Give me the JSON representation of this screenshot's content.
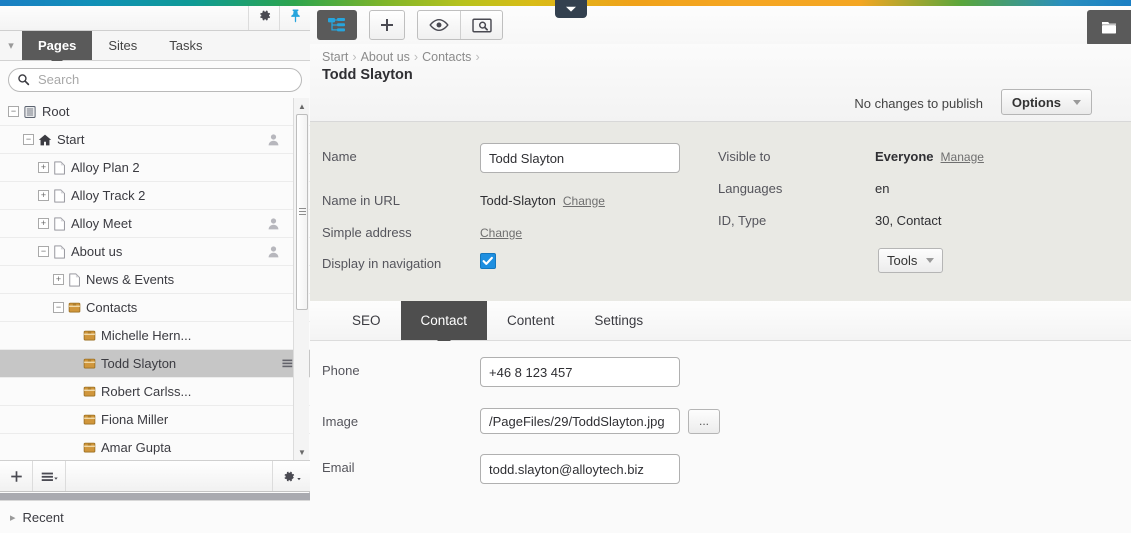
{
  "sidebar": {
    "topbar_icons": [
      {
        "name": "gear-icon",
        "label": "Settings"
      },
      {
        "name": "pin-icon",
        "label": "Pin panel"
      }
    ],
    "tabs": [
      {
        "label": "Pages",
        "active": true
      },
      {
        "label": "Sites",
        "active": false
      },
      {
        "label": "Tasks",
        "active": false
      }
    ],
    "search": {
      "placeholder": "Search",
      "value": ""
    },
    "tree": [
      {
        "label": "Root",
        "indent": 0,
        "expander": "minus",
        "icon": "root-icon",
        "user": false,
        "selected": false
      },
      {
        "label": "Start",
        "indent": 1,
        "expander": "minus",
        "icon": "home-icon",
        "user": true,
        "selected": false
      },
      {
        "label": "Alloy Plan 2",
        "indent": 2,
        "expander": "plus",
        "icon": "page-icon",
        "user": false,
        "selected": false
      },
      {
        "label": "Alloy Track 2",
        "indent": 2,
        "expander": "plus",
        "icon": "page-icon",
        "user": false,
        "selected": false
      },
      {
        "label": "Alloy Meet",
        "indent": 2,
        "expander": "plus",
        "icon": "page-icon",
        "user": true,
        "selected": false
      },
      {
        "label": "About us",
        "indent": 2,
        "expander": "minus",
        "icon": "page-icon",
        "user": true,
        "selected": false
      },
      {
        "label": "News & Events",
        "indent": 3,
        "expander": "plus",
        "icon": "page-icon",
        "user": false,
        "selected": false
      },
      {
        "label": "Contacts",
        "indent": 3,
        "expander": "minus",
        "icon": "contact-icon",
        "user": false,
        "selected": false
      },
      {
        "label": "Michelle Hern...",
        "indent": 4,
        "expander": "none",
        "icon": "contact-icon",
        "user": false,
        "selected": false
      },
      {
        "label": "Todd Slayton",
        "indent": 4,
        "expander": "none",
        "icon": "contact-icon",
        "user": false,
        "selected": true
      },
      {
        "label": "Robert Carlss...",
        "indent": 4,
        "expander": "none",
        "icon": "contact-icon",
        "user": false,
        "selected": false
      },
      {
        "label": "Fiona Miller",
        "indent": 4,
        "expander": "none",
        "icon": "contact-icon",
        "user": false,
        "selected": false
      },
      {
        "label": "Amar Gupta",
        "indent": 4,
        "expander": "none",
        "icon": "contact-icon",
        "user": false,
        "selected": false
      }
    ],
    "bottom_toolbar": [
      {
        "name": "add-page-button",
        "icon": "plus-icon"
      },
      {
        "name": "list-menu-button",
        "icon": "hamburger-menu-icon"
      },
      {
        "name": "settings-button",
        "icon": "gear-icon"
      }
    ],
    "recent": {
      "label": "Recent"
    }
  },
  "toolbar": {
    "sitemap_icon": "sitemap-icon",
    "add_icon": "plus-icon",
    "preview_icon": "eye-icon",
    "view_icon": "screen-search-icon",
    "folder_icon": "folder-icon",
    "handle_icon": "chevron-down-icon"
  },
  "header": {
    "breadcrumb": [
      "Start",
      "About us",
      "Contacts"
    ],
    "title": "Todd Slayton",
    "publish_status": "No changes to publish",
    "options_label": "Options"
  },
  "properties": {
    "name_label": "Name",
    "name_value": "Todd Slayton",
    "name_in_url_label": "Name in URL",
    "name_in_url_value": "Todd-Slayton",
    "name_in_url_change": "Change",
    "simple_address_label": "Simple address",
    "simple_address_change": "Change",
    "display_in_navigation_label": "Display in navigation",
    "display_in_navigation_checked": true,
    "visible_to_label": "Visible to",
    "visible_to_value": "Everyone",
    "visible_to_manage": "Manage",
    "languages_label": "Languages",
    "languages_value": "en",
    "id_type_label": "ID, Type",
    "id_type_value": "30, Contact",
    "tools_label": "Tools"
  },
  "content_tabs": [
    {
      "label": "SEO",
      "active": false
    },
    {
      "label": "Contact",
      "active": true
    },
    {
      "label": "Content",
      "active": false
    },
    {
      "label": "Settings",
      "active": false
    }
  ],
  "contact_form": {
    "phone_label": "Phone",
    "phone_value": "+46 8 123 457",
    "image_label": "Image",
    "image_value": "/PageFiles/29/ToddSlayton.jpg",
    "image_browse_label": "...",
    "email_label": "Email",
    "email_value": "todd.slayton@alloytech.biz"
  },
  "colors": {
    "accent_blue": "#1e8fe0",
    "active_tab_dark": "#4e4e4e",
    "props_panel_bg": "#e9e9e4",
    "selection_gray": "#c6c6c6",
    "folder_icon_gold": "#c79a3e"
  }
}
